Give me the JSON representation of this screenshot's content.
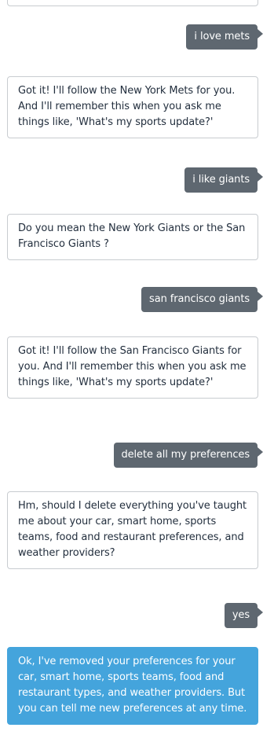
{
  "messages": [
    {
      "role": "user",
      "text": "i love mets"
    },
    {
      "role": "bot",
      "text": "Got it! I'll follow the New York Mets for you. And I'll remember this when you ask me things like, 'What's my sports update?'"
    },
    {
      "role": "user",
      "text": "i like giants"
    },
    {
      "role": "bot",
      "text": "Do you mean the New York Giants or the San Francisco Giants ?"
    },
    {
      "role": "user",
      "text": "san francisco giants"
    },
    {
      "role": "bot",
      "text": "Got it! I'll follow the San Francisco Giants for you. And I'll remember this when you ask me things like, 'What's my sports update?'"
    },
    {
      "role": "user",
      "text": "delete all my preferences"
    },
    {
      "role": "bot",
      "text": "Hm, should I delete everything you've taught me about your car, smart home, sports teams, food and restaurant preferences, and weather providers?"
    },
    {
      "role": "user",
      "text": "yes"
    },
    {
      "role": "bot",
      "text": "Ok, I've removed your preferences for your car, smart home, sports teams, food and restaurant types, and weather providers. But you can tell me new preferences at any time."
    }
  ],
  "colors": {
    "user_bubble": "#5e6770",
    "bot_border": "#c8ccd0",
    "bot_text": "#232f3e",
    "latest_bot_bubble": "#44a4dc"
  }
}
